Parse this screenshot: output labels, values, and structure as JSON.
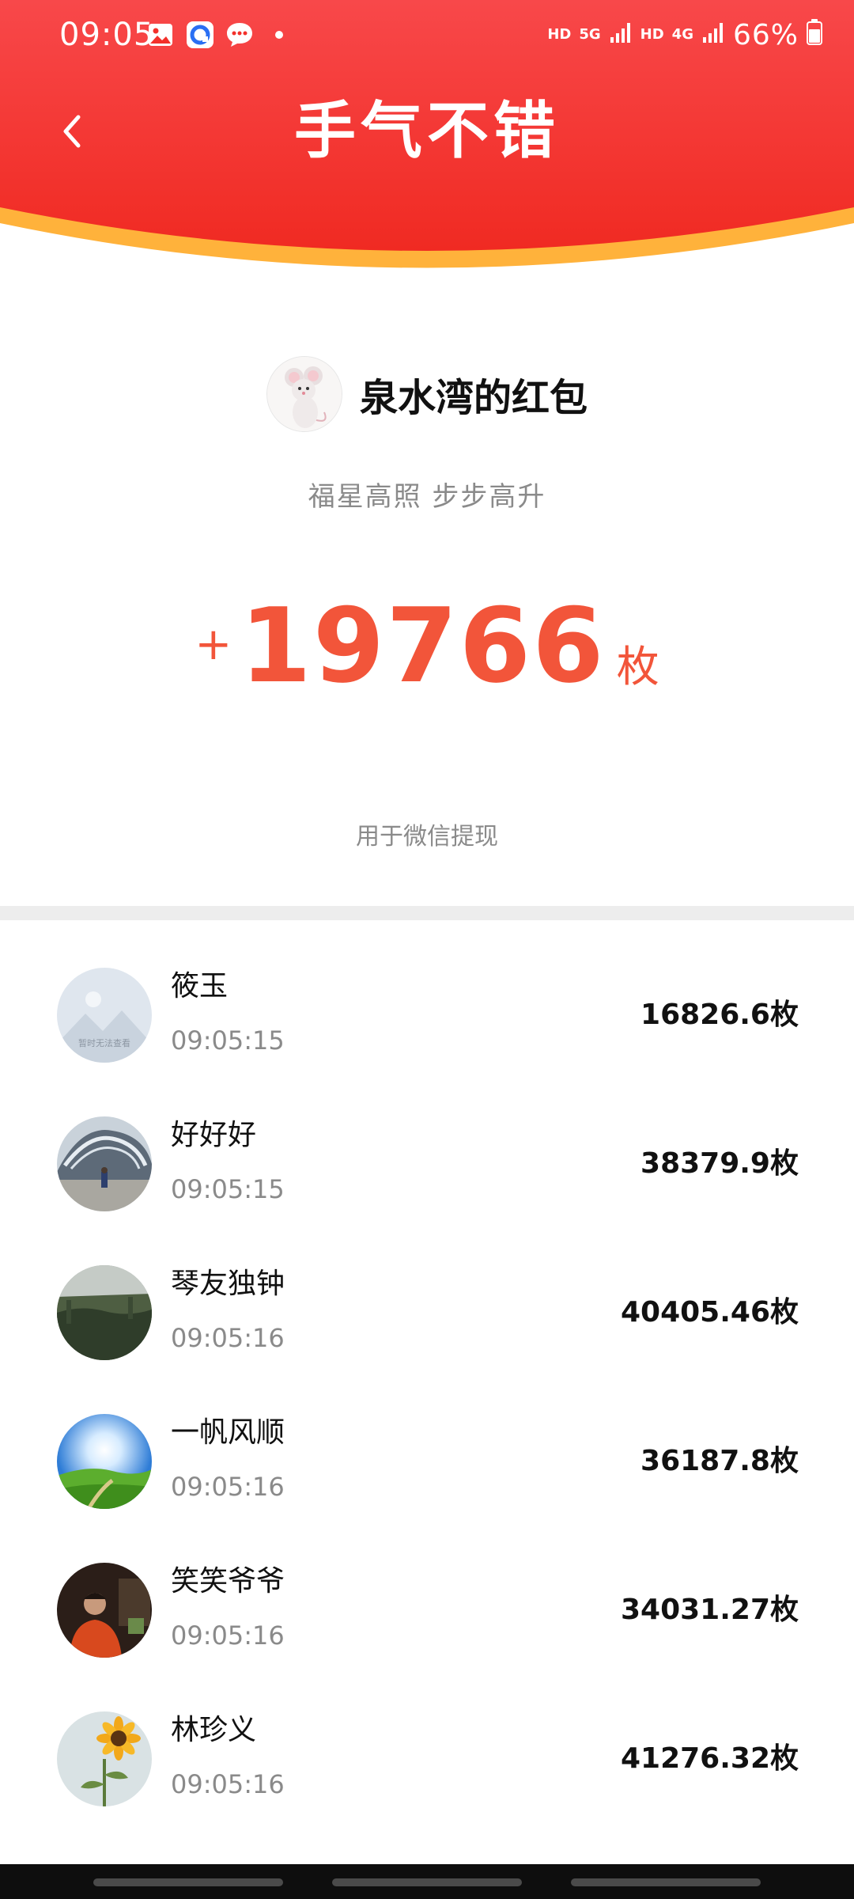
{
  "status_bar": {
    "time": "09:05",
    "net1": "HD",
    "net2": "5G",
    "net3": "HD",
    "net4": "4G",
    "battery": "66%"
  },
  "header": {
    "title": "手气不错",
    "accent_red": "#f3302a",
    "accent_gold": "#ffb23b"
  },
  "sender": {
    "name": "泉水湾的红包",
    "avatar_icon": "mouse-icon"
  },
  "blessing": "福星高照 步步高升",
  "amount": {
    "plus": "+",
    "value": "19766",
    "unit": "枚",
    "color": "#f2553a"
  },
  "amount_note": "用于微信提现",
  "recipients": [
    {
      "name": "筱玉",
      "time": "09:05:15",
      "amount": "16826.6枚",
      "avatar_note": "暂时无法查看"
    },
    {
      "name": "好好好",
      "time": "09:05:15",
      "amount": "38379.9枚"
    },
    {
      "name": "琴友独钟",
      "time": "09:05:16",
      "amount": "40405.46枚"
    },
    {
      "name": "一帆风顺",
      "time": "09:05:16",
      "amount": "36187.8枚"
    },
    {
      "name": "笑笑爷爷",
      "time": "09:05:16",
      "amount": "34031.27枚"
    },
    {
      "name": "林珍义",
      "time": "09:05:16",
      "amount": "41276.32枚"
    }
  ]
}
